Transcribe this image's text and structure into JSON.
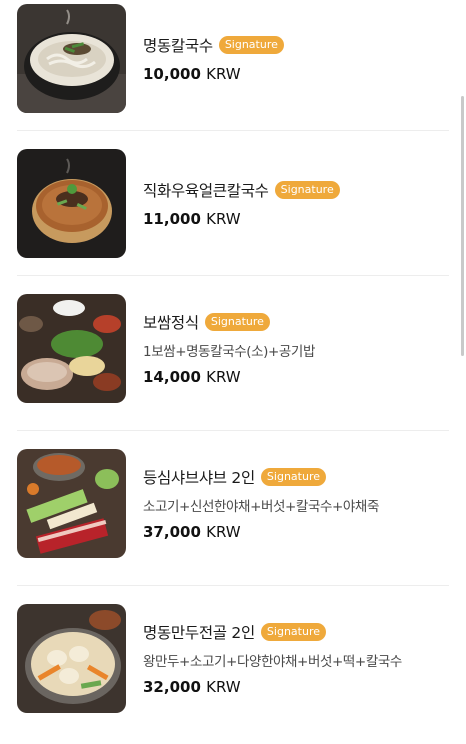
{
  "menu": {
    "items": [
      {
        "name": "명동칼국수",
        "badge": "Signature",
        "description": "",
        "price": "10,000",
        "currency": "KRW",
        "image_icon": "noodle-soup-bowl"
      },
      {
        "name": "직화우육얼큰칼국수",
        "badge": "Signature",
        "description": "",
        "price": "11,000",
        "currency": "KRW",
        "image_icon": "spicy-beef-noodle-bowl"
      },
      {
        "name": "보쌈정식",
        "badge": "Signature",
        "description": "1보쌈+명동칼국수(소)+공기밥",
        "price": "14,000",
        "currency": "KRW",
        "image_icon": "bossam-set-meal"
      },
      {
        "name": "등심샤브샤브 2인",
        "badge": "Signature",
        "description": "소고기+신선한야채+버섯+칼국수+야채죽",
        "price": "37,000",
        "currency": "KRW",
        "image_icon": "shabu-shabu-platter"
      },
      {
        "name": "명동만두전골 2인",
        "badge": "Signature",
        "description": "왕만두+소고기+다양한야채+버섯+떡+칼국수",
        "price": "32,000",
        "currency": "KRW",
        "image_icon": "dumpling-hotpot"
      }
    ]
  },
  "colors": {
    "badge": "#efa93b",
    "divider": "#ededed",
    "text": "#1a1a1a"
  }
}
